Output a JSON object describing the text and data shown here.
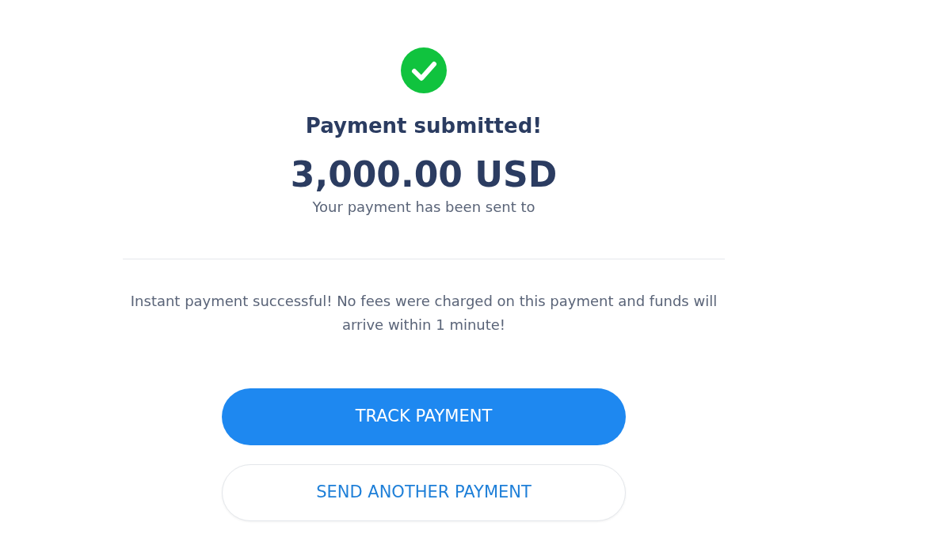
{
  "status": {
    "title": "Payment submitted!",
    "amount": "3,000.00 USD",
    "recipient_line": "Your payment has been sent to"
  },
  "message": "Instant payment successful! No fees were charged on this payment and funds will arrive within 1 minute!",
  "buttons": [
    {
      "label": "TRACK PAYMENT",
      "kind": "primary"
    },
    {
      "label": "SEND ANOTHER PAYMENT",
      "kind": "secondary"
    }
  ]
}
